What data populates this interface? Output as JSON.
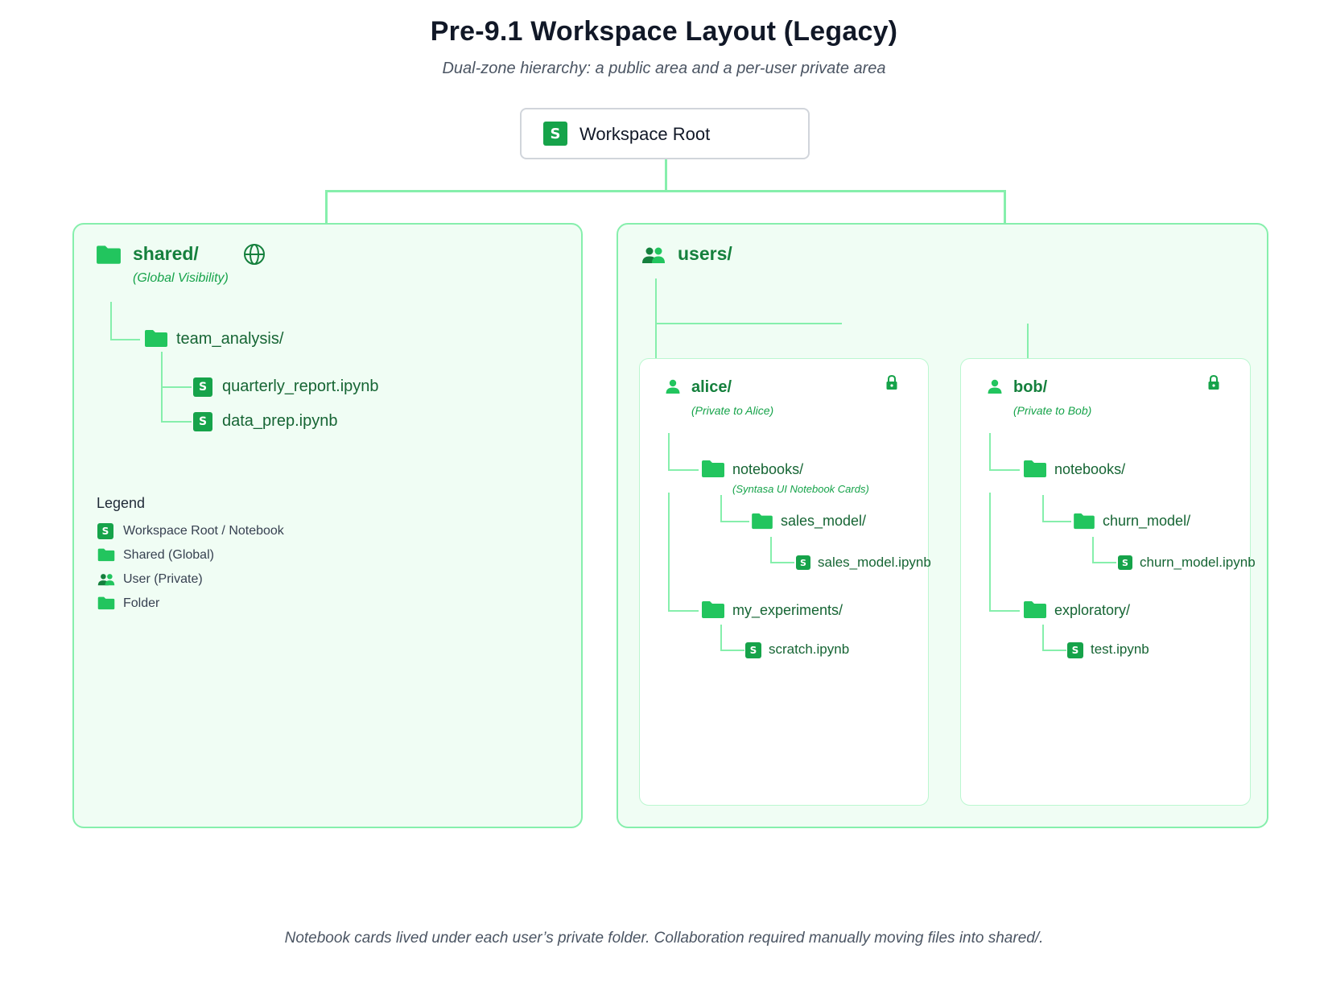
{
  "title": "Pre-9.1 Workspace Layout (Legacy)",
  "subtitle": "Dual-zone hierarchy: a public area and a per-user private area",
  "root": {
    "badge": "S",
    "label": "Workspace Root"
  },
  "shared": {
    "label": "shared/",
    "note": "(Global Visibility)",
    "folder": "team_analysis/",
    "files": [
      "quarterly_report.ipynb",
      "data_prep.ipynb"
    ]
  },
  "legend": {
    "title": "Legend",
    "items": [
      "Workspace Root / Notebook",
      "Shared (Global)",
      "User (Private)",
      "Folder"
    ]
  },
  "users": {
    "label": "users/",
    "alice": {
      "label": "alice/",
      "note": "(Private to Alice)",
      "notebooks": "notebooks/",
      "notebooks_note": "(Syntasa UI Notebook Cards)",
      "model_folder": "sales_model/",
      "model_file": "sales_model.ipynb",
      "exp_folder": "my_experiments/",
      "exp_file": "scratch.ipynb"
    },
    "bob": {
      "label": "bob/",
      "note": "(Private to Bob)",
      "notebooks": "notebooks/",
      "model_folder": "churn_model/",
      "model_file": "churn_model.ipynb",
      "exp_folder": "exploratory/",
      "exp_file": "test.ipynb"
    }
  },
  "footer": "Notebook cards lived under each user’s private folder. Collaboration required manually moving files into shared/.",
  "colors": {
    "accent": "#16a34a",
    "panel_border": "#86efac",
    "panel_fill": "#f0fdf4",
    "text_green": "#15803d"
  }
}
